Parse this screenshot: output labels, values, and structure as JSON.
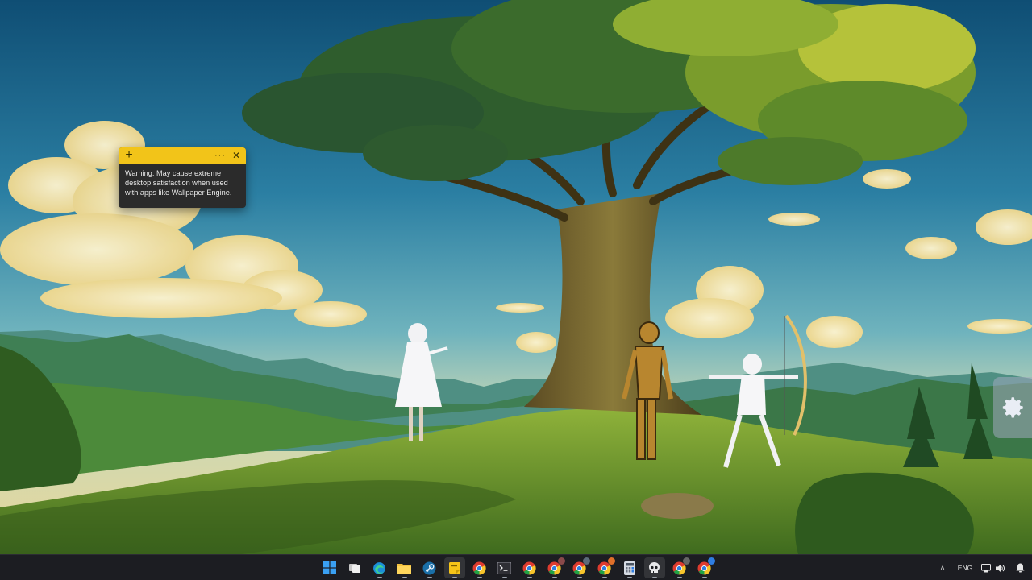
{
  "sticky_note": {
    "add_glyph": "+",
    "more_glyph": "···",
    "close_glyph": "✕",
    "text": "Warning: May cause extreme desktop satisfaction when used with apps like Wallpaper Engine.",
    "header_color": "#f2c419",
    "body_color": "#2b2b2b"
  },
  "taskbar": {
    "apps": [
      {
        "name": "start",
        "icon": "windows-logo-icon"
      },
      {
        "name": "task-view",
        "icon": "task-view-icon"
      },
      {
        "name": "edge",
        "icon": "edge-icon"
      },
      {
        "name": "file-explorer",
        "icon": "folder-icon"
      },
      {
        "name": "steam",
        "icon": "steam-icon"
      },
      {
        "name": "sticky-notes",
        "icon": "sticky-notes-icon"
      },
      {
        "name": "chrome",
        "icon": "chrome-icon"
      },
      {
        "name": "terminal",
        "icon": "terminal-icon"
      },
      {
        "name": "chrome-2",
        "icon": "chrome-icon"
      },
      {
        "name": "chrome-3",
        "icon": "chrome-icon"
      },
      {
        "name": "chrome-4",
        "icon": "chrome-icon"
      },
      {
        "name": "chrome-5",
        "icon": "chrome-icon"
      },
      {
        "name": "calculator",
        "icon": "calculator-icon"
      },
      {
        "name": "wallpaper-app",
        "icon": "skull-icon"
      },
      {
        "name": "chrome-6",
        "icon": "chrome-icon"
      },
      {
        "name": "chrome-7",
        "icon": "chrome-icon"
      }
    ],
    "tray": {
      "language": "ENG",
      "chevron_glyph": "˄"
    }
  },
  "colors": {
    "taskbar_bg": "#1c1d22",
    "sticky_yellow": "#f2c419"
  }
}
